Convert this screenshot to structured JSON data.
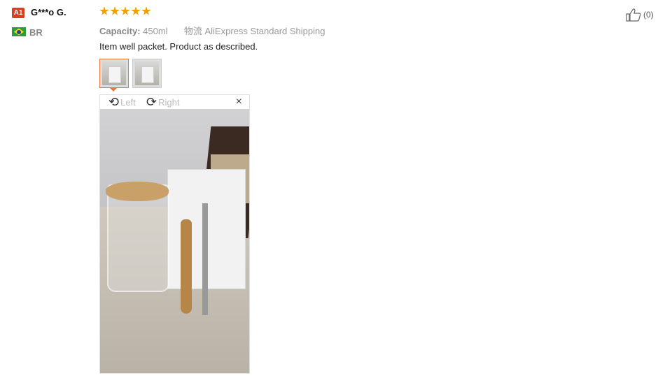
{
  "reviewer": {
    "badge": "A1",
    "name": "G***o G.",
    "country": "BR",
    "flag_icon": "brazil-flag-icon"
  },
  "rating": {
    "stars": 5,
    "max": 5,
    "color": "#f0a000"
  },
  "attributes": {
    "capacity_label": "Capacity:",
    "capacity_value": "450ml",
    "shipping_label": "物流",
    "shipping_value": "AliExpress Standard Shipping"
  },
  "review_text": "Item well packet. Product as described.",
  "helpful": {
    "icon": "thumbs-up-icon",
    "count": "(0)"
  },
  "thumbnails": [
    {
      "active": true
    },
    {
      "active": false
    }
  ],
  "viewer": {
    "rotate_left": "Left",
    "rotate_right": "Right",
    "close": "×"
  },
  "colors": {
    "accent": "#e8793a",
    "badge": "#d6401c"
  }
}
